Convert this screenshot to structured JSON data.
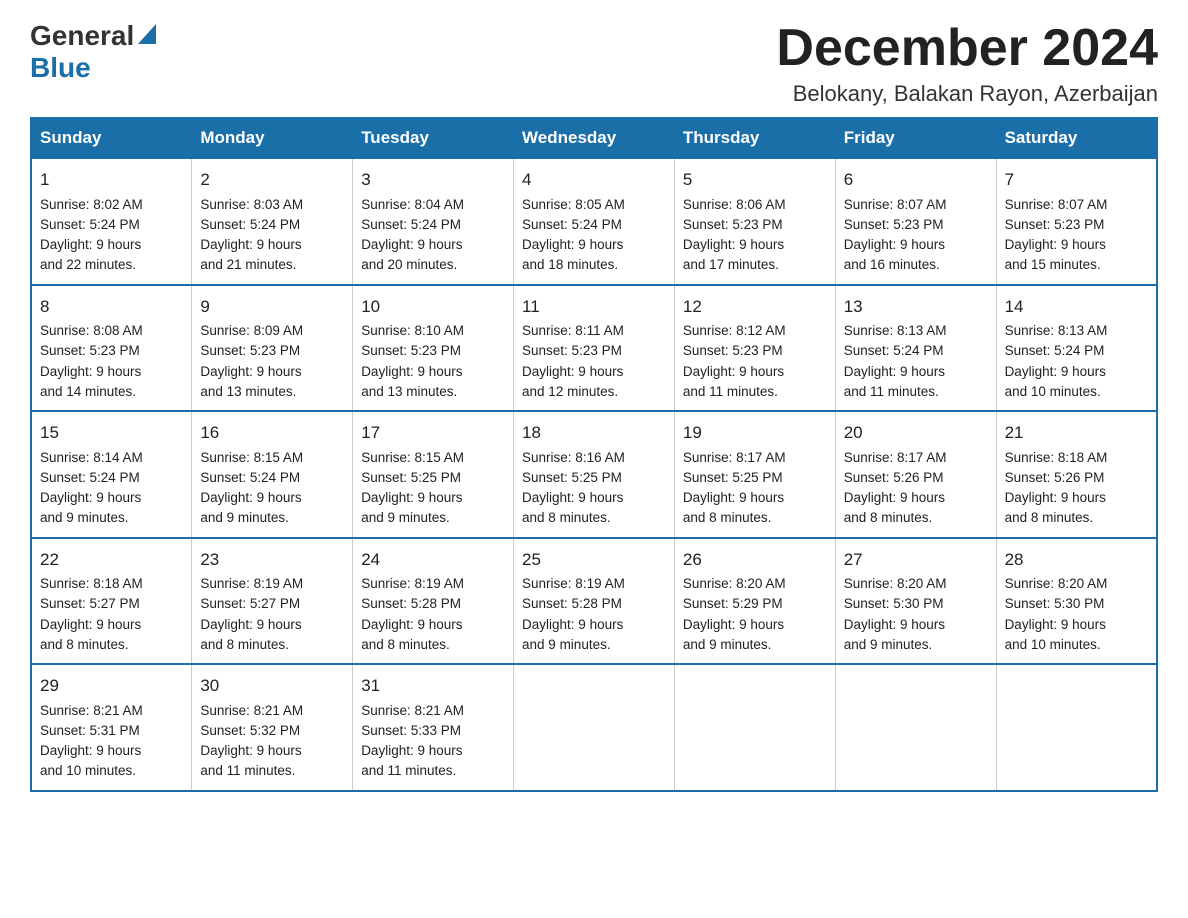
{
  "header": {
    "logo_general": "General",
    "logo_blue": "Blue",
    "month_title": "December 2024",
    "location": "Belokany, Balakan Rayon, Azerbaijan"
  },
  "days_of_week": [
    "Sunday",
    "Monday",
    "Tuesday",
    "Wednesday",
    "Thursday",
    "Friday",
    "Saturday"
  ],
  "weeks": [
    [
      {
        "day": "1",
        "sunrise": "Sunrise: 8:02 AM",
        "sunset": "Sunset: 5:24 PM",
        "daylight": "Daylight: 9 hours",
        "daylight2": "and 22 minutes."
      },
      {
        "day": "2",
        "sunrise": "Sunrise: 8:03 AM",
        "sunset": "Sunset: 5:24 PM",
        "daylight": "Daylight: 9 hours",
        "daylight2": "and 21 minutes."
      },
      {
        "day": "3",
        "sunrise": "Sunrise: 8:04 AM",
        "sunset": "Sunset: 5:24 PM",
        "daylight": "Daylight: 9 hours",
        "daylight2": "and 20 minutes."
      },
      {
        "day": "4",
        "sunrise": "Sunrise: 8:05 AM",
        "sunset": "Sunset: 5:24 PM",
        "daylight": "Daylight: 9 hours",
        "daylight2": "and 18 minutes."
      },
      {
        "day": "5",
        "sunrise": "Sunrise: 8:06 AM",
        "sunset": "Sunset: 5:23 PM",
        "daylight": "Daylight: 9 hours",
        "daylight2": "and 17 minutes."
      },
      {
        "day": "6",
        "sunrise": "Sunrise: 8:07 AM",
        "sunset": "Sunset: 5:23 PM",
        "daylight": "Daylight: 9 hours",
        "daylight2": "and 16 minutes."
      },
      {
        "day": "7",
        "sunrise": "Sunrise: 8:07 AM",
        "sunset": "Sunset: 5:23 PM",
        "daylight": "Daylight: 9 hours",
        "daylight2": "and 15 minutes."
      }
    ],
    [
      {
        "day": "8",
        "sunrise": "Sunrise: 8:08 AM",
        "sunset": "Sunset: 5:23 PM",
        "daylight": "Daylight: 9 hours",
        "daylight2": "and 14 minutes."
      },
      {
        "day": "9",
        "sunrise": "Sunrise: 8:09 AM",
        "sunset": "Sunset: 5:23 PM",
        "daylight": "Daylight: 9 hours",
        "daylight2": "and 13 minutes."
      },
      {
        "day": "10",
        "sunrise": "Sunrise: 8:10 AM",
        "sunset": "Sunset: 5:23 PM",
        "daylight": "Daylight: 9 hours",
        "daylight2": "and 13 minutes."
      },
      {
        "day": "11",
        "sunrise": "Sunrise: 8:11 AM",
        "sunset": "Sunset: 5:23 PM",
        "daylight": "Daylight: 9 hours",
        "daylight2": "and 12 minutes."
      },
      {
        "day": "12",
        "sunrise": "Sunrise: 8:12 AM",
        "sunset": "Sunset: 5:23 PM",
        "daylight": "Daylight: 9 hours",
        "daylight2": "and 11 minutes."
      },
      {
        "day": "13",
        "sunrise": "Sunrise: 8:13 AM",
        "sunset": "Sunset: 5:24 PM",
        "daylight": "Daylight: 9 hours",
        "daylight2": "and 11 minutes."
      },
      {
        "day": "14",
        "sunrise": "Sunrise: 8:13 AM",
        "sunset": "Sunset: 5:24 PM",
        "daylight": "Daylight: 9 hours",
        "daylight2": "and 10 minutes."
      }
    ],
    [
      {
        "day": "15",
        "sunrise": "Sunrise: 8:14 AM",
        "sunset": "Sunset: 5:24 PM",
        "daylight": "Daylight: 9 hours",
        "daylight2": "and 9 minutes."
      },
      {
        "day": "16",
        "sunrise": "Sunrise: 8:15 AM",
        "sunset": "Sunset: 5:24 PM",
        "daylight": "Daylight: 9 hours",
        "daylight2": "and 9 minutes."
      },
      {
        "day": "17",
        "sunrise": "Sunrise: 8:15 AM",
        "sunset": "Sunset: 5:25 PM",
        "daylight": "Daylight: 9 hours",
        "daylight2": "and 9 minutes."
      },
      {
        "day": "18",
        "sunrise": "Sunrise: 8:16 AM",
        "sunset": "Sunset: 5:25 PM",
        "daylight": "Daylight: 9 hours",
        "daylight2": "and 8 minutes."
      },
      {
        "day": "19",
        "sunrise": "Sunrise: 8:17 AM",
        "sunset": "Sunset: 5:25 PM",
        "daylight": "Daylight: 9 hours",
        "daylight2": "and 8 minutes."
      },
      {
        "day": "20",
        "sunrise": "Sunrise: 8:17 AM",
        "sunset": "Sunset: 5:26 PM",
        "daylight": "Daylight: 9 hours",
        "daylight2": "and 8 minutes."
      },
      {
        "day": "21",
        "sunrise": "Sunrise: 8:18 AM",
        "sunset": "Sunset: 5:26 PM",
        "daylight": "Daylight: 9 hours",
        "daylight2": "and 8 minutes."
      }
    ],
    [
      {
        "day": "22",
        "sunrise": "Sunrise: 8:18 AM",
        "sunset": "Sunset: 5:27 PM",
        "daylight": "Daylight: 9 hours",
        "daylight2": "and 8 minutes."
      },
      {
        "day": "23",
        "sunrise": "Sunrise: 8:19 AM",
        "sunset": "Sunset: 5:27 PM",
        "daylight": "Daylight: 9 hours",
        "daylight2": "and 8 minutes."
      },
      {
        "day": "24",
        "sunrise": "Sunrise: 8:19 AM",
        "sunset": "Sunset: 5:28 PM",
        "daylight": "Daylight: 9 hours",
        "daylight2": "and 8 minutes."
      },
      {
        "day": "25",
        "sunrise": "Sunrise: 8:19 AM",
        "sunset": "Sunset: 5:28 PM",
        "daylight": "Daylight: 9 hours",
        "daylight2": "and 9 minutes."
      },
      {
        "day": "26",
        "sunrise": "Sunrise: 8:20 AM",
        "sunset": "Sunset: 5:29 PM",
        "daylight": "Daylight: 9 hours",
        "daylight2": "and 9 minutes."
      },
      {
        "day": "27",
        "sunrise": "Sunrise: 8:20 AM",
        "sunset": "Sunset: 5:30 PM",
        "daylight": "Daylight: 9 hours",
        "daylight2": "and 9 minutes."
      },
      {
        "day": "28",
        "sunrise": "Sunrise: 8:20 AM",
        "sunset": "Sunset: 5:30 PM",
        "daylight": "Daylight: 9 hours",
        "daylight2": "and 10 minutes."
      }
    ],
    [
      {
        "day": "29",
        "sunrise": "Sunrise: 8:21 AM",
        "sunset": "Sunset: 5:31 PM",
        "daylight": "Daylight: 9 hours",
        "daylight2": "and 10 minutes."
      },
      {
        "day": "30",
        "sunrise": "Sunrise: 8:21 AM",
        "sunset": "Sunset: 5:32 PM",
        "daylight": "Daylight: 9 hours",
        "daylight2": "and 11 minutes."
      },
      {
        "day": "31",
        "sunrise": "Sunrise: 8:21 AM",
        "sunset": "Sunset: 5:33 PM",
        "daylight": "Daylight: 9 hours",
        "daylight2": "and 11 minutes."
      },
      null,
      null,
      null,
      null
    ]
  ]
}
